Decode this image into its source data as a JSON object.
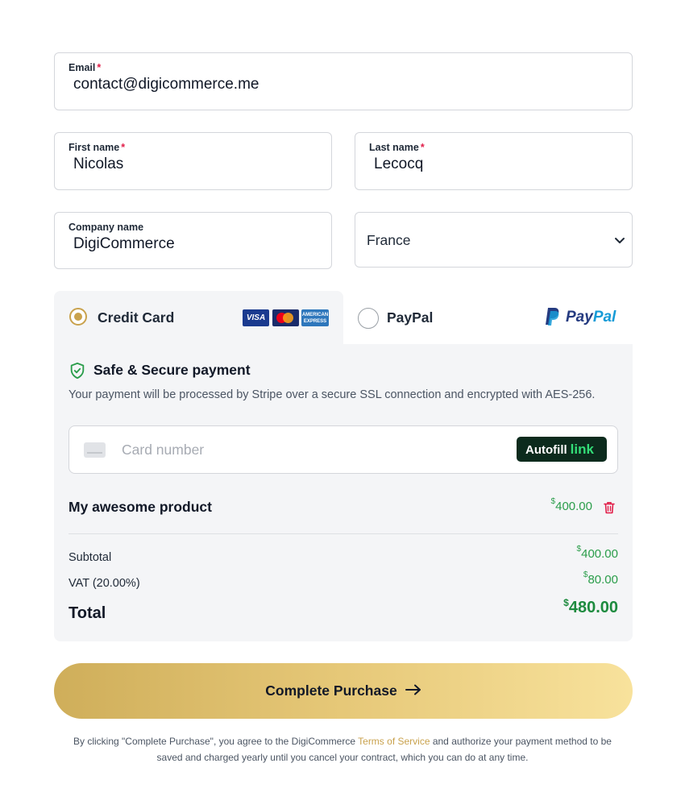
{
  "form": {
    "email": {
      "label": "Email",
      "required": "*",
      "value": "contact@digicommerce.me"
    },
    "first_name": {
      "label": "First name",
      "required": "*",
      "value": "Nicolas"
    },
    "last_name": {
      "label": "Last name",
      "required": "*",
      "value": "Lecocq"
    },
    "company": {
      "label": "Company name",
      "value": "DigiCommerce"
    },
    "country": {
      "value": "France"
    }
  },
  "payment": {
    "tabs": [
      {
        "label": "Credit Card",
        "selected": true
      },
      {
        "label": "PayPal",
        "selected": false
      }
    ],
    "card_brands": {
      "visa": "VISA",
      "amex_line1": "AMERICAN",
      "amex_line2": "EXPRESS"
    },
    "paypal_logo": {
      "part1": "Pay",
      "part2": "Pal"
    },
    "secure_title": "Safe & Secure payment",
    "secure_desc": "Your payment will be processed by Stripe over a secure SSL connection and encrypted with AES-256.",
    "card_placeholder": "Card number",
    "autofill": {
      "label": "Autofill",
      "link": "link"
    }
  },
  "order": {
    "product_name": "My awesome product",
    "product_price": "400.00",
    "currency": "$",
    "subtotal_label": "Subtotal",
    "subtotal_value": "400.00",
    "vat_label": "VAT (20.00%)",
    "vat_value": "80.00",
    "total_label": "Total",
    "total_value": "480.00"
  },
  "cta": {
    "label": "Complete Purchase"
  },
  "terms": {
    "before": "By clicking \"Complete Purchase\", you agree to the DigiCommerce ",
    "link": "Terms of Service",
    "after": " and authorize your payment method to be saved and charged yearly until you cancel your contract, which you can do at any time."
  },
  "colors": {
    "accent": "#c9a24d",
    "money": "#2a9d4a",
    "required": "#e11d48"
  }
}
